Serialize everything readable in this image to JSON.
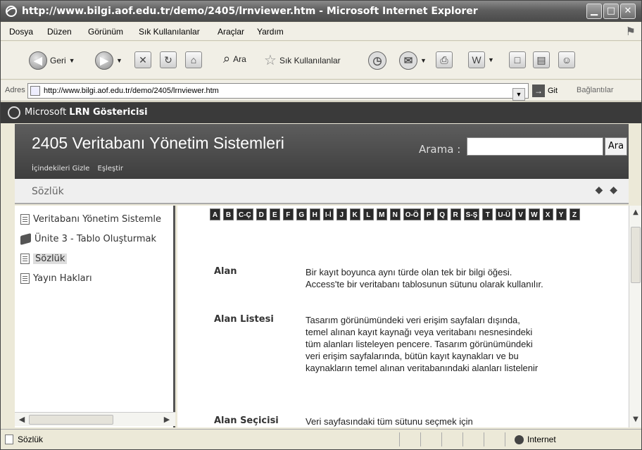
{
  "browser": {
    "title": "http://www.bilgi.aof.edu.tr/demo/2405/lrnviewer.htm - Microsoft Internet Explorer",
    "menu": [
      "Dosya",
      "Düzen",
      "Görünüm",
      "Sık Kullanılanlar",
      "Araçlar",
      "Yardım"
    ],
    "toolbar": {
      "back": "Geri",
      "search": "Ara",
      "favorites": "Sık Kullanılanlar"
    },
    "address": {
      "label": "Adres",
      "url": "http://www.bilgi.aof.edu.tr/demo/2405/lrnviewer.htm",
      "go": "Git",
      "links": "Bağlantılar"
    },
    "status": {
      "text": "Sözlük",
      "zone": "Internet"
    }
  },
  "viewer": {
    "brand_prefix": "Microsoft ",
    "brand_bold": "LRN Göstericisi",
    "course_title": "2405 Veritabanı Yönetim Sistemleri",
    "links": [
      "İçindekileri Gizle",
      "Eşleştir"
    ],
    "search_label": "Arama :",
    "search_value": "",
    "search_button": "Ara",
    "breadcrumb": "Sözlük",
    "nav_prev": "◆",
    "nav_next": "◆"
  },
  "toc": [
    {
      "label": "Veritabanı Yönetim Sistemle",
      "icon": "document-icon"
    },
    {
      "label": "Ünite 3 - Tablo Oluşturmak",
      "icon": "book-icon"
    },
    {
      "label": "Sözlük",
      "icon": "document-icon",
      "selected": true
    },
    {
      "label": "Yayın Hakları",
      "icon": "document-icon"
    }
  ],
  "letters": [
    "A",
    "B",
    "C-Ç",
    "D",
    "E",
    "F",
    "G",
    "H",
    "I-İ",
    "J",
    "K",
    "L",
    "M",
    "N",
    "O-Ö",
    "P",
    "Q",
    "R",
    "S-Ş",
    "T",
    "U-Ü",
    "V",
    "W",
    "X",
    "Y",
    "Z"
  ],
  "glossary": [
    {
      "term": "Alan",
      "definition": "Bir kayıt boyunca aynı türde olan tek bir bilgi öğesi. Access'te bir veritabanı tablosunun sütunu olarak kullanılır."
    },
    {
      "term": "Alan Listesi",
      "definition": "Tasarım görünümündeki veri erişim sayfaları dışında, temel alınan kayıt kaynağı veya veritabanı nesnesindeki tüm alanları listeleyen pencere. Tasarım görünümündeki veri erişim sayfalarında, bütün kayıt kaynakları ve bu kaynakların temel alınan veritabanındaki alanları listelenir"
    },
    {
      "term": "Alan Seçicisi",
      "definition": "Veri sayfasındaki tüm sütunu seçmek için"
    }
  ]
}
